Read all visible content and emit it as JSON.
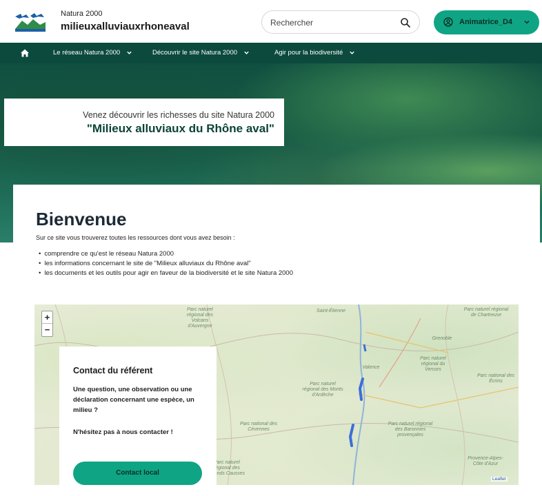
{
  "header": {
    "brand_small": "Natura 2000",
    "brand_site": "milieuxalluviauxrhoneaval",
    "logo_icon": "natura2000-logo-icon",
    "search_placeholder": "Rechercher",
    "user_label": "Animatrice_D4"
  },
  "nav": {
    "items": [
      {
        "label": "Le réseau Natura 2000"
      },
      {
        "label": "Découvrir le site Natura 2000"
      },
      {
        "label": "Agir pour la biodiversité"
      }
    ]
  },
  "hero": {
    "subtitle": "Venez découvrir les richesses du site Natura 2000",
    "title": "\"Milieux alluviaux du Rhône aval\""
  },
  "welcome": {
    "title": "Bienvenue",
    "intro": "Sur ce site vous trouverez toutes les ressources dont vous avez besoin :",
    "items": [
      "comprendre ce qu'est le réseau Natura 2000",
      "les informations concernant le site de \"Milieux alluviaux du Rhône aval\"",
      "les documents et les outils pour agir en faveur de la biodiversité et le site Natura 2000"
    ]
  },
  "map": {
    "zoom_in": "+",
    "zoom_out": "−",
    "labels": {
      "volcans": "Parc naturel régional des Volcans d'Auvergne",
      "saint_etienne": "Saint-Étienne",
      "chartreuse": "Parc naturel régional de Chartreuse",
      "grenoble": "Grenoble",
      "vercors": "Parc naturel régional du Vercors",
      "valence": "Valence",
      "monts_ardeche": "Parc naturel régional des Monts d'Ardèche",
      "oisans": "Parc national des Écrins",
      "causses": "Parc naturel régional des Grands Causses",
      "baronnies": "Parc naturel régional des Baronnies provençales",
      "cevennes": "Parc national des Cévennes",
      "provence": "Provence-Alpes-Côte d'Azur",
      "attribution": "Leaflet"
    },
    "site_color": "#3b6fd8"
  },
  "contact": {
    "title": "Contact du référent",
    "text": "Une question, une observation ou une déclaration concernant une espèce, un milieu ?",
    "cta": "N'hésitez pas à nous contacter !",
    "button": "Contact local"
  },
  "colors": {
    "accent": "#0fa584",
    "nav": "#0c4a3d",
    "title": "#0b4336"
  }
}
